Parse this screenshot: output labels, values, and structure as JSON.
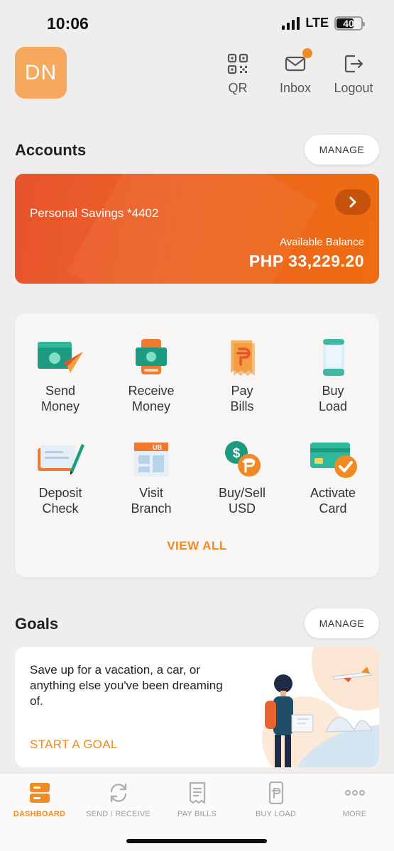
{
  "status_bar": {
    "time": "10:06",
    "network": "LTE",
    "battery": "40"
  },
  "header": {
    "avatar_initials": "DN",
    "qr_label": "QR",
    "inbox_label": "Inbox",
    "logout_label": "Logout"
  },
  "accounts": {
    "title": "Accounts",
    "manage_label": "MANAGE",
    "card": {
      "name": "Personal Savings *4402",
      "balance_label": "Available Balance",
      "balance": "PHP 33,229.20"
    }
  },
  "actions": {
    "items": [
      {
        "line1": "Send",
        "line2": "Money",
        "icon": "send-money-icon"
      },
      {
        "line1": "Receive",
        "line2": "Money",
        "icon": "receive-money-icon"
      },
      {
        "line1": "Pay",
        "line2": "Bills",
        "icon": "pay-bills-icon"
      },
      {
        "line1": "Buy",
        "line2": "Load",
        "icon": "buy-load-icon"
      },
      {
        "line1": "Deposit",
        "line2": "Check",
        "icon": "deposit-check-icon"
      },
      {
        "line1": "Visit",
        "line2": "Branch",
        "icon": "visit-branch-icon"
      },
      {
        "line1": "Buy/Sell",
        "line2": "USD",
        "icon": "buy-sell-usd-icon"
      },
      {
        "line1": "Activate",
        "line2": "Card",
        "icon": "activate-card-icon"
      }
    ],
    "view_all_label": "VIEW ALL"
  },
  "goals": {
    "title": "Goals",
    "manage_label": "MANAGE",
    "description": "Save up for a vacation, a car, or anything else you've been dreaming of.",
    "start_label": "START A GOAL"
  },
  "bottom_nav": {
    "items": [
      {
        "label": "DASHBOARD",
        "icon": "dashboard-icon",
        "active": true
      },
      {
        "label": "SEND / RECEIVE",
        "icon": "refresh-icon",
        "active": false
      },
      {
        "label": "PAY BILLS",
        "icon": "receipt-icon",
        "active": false
      },
      {
        "label": "BUY LOAD",
        "icon": "phone-load-icon",
        "active": false
      },
      {
        "label": "MORE",
        "icon": "more-dots-icon",
        "active": false
      }
    ]
  },
  "colors": {
    "accent": "#f08a24",
    "card_gradient_start": "#e8532e",
    "card_gradient_end": "#ef6c0f",
    "background": "#efeeed"
  }
}
